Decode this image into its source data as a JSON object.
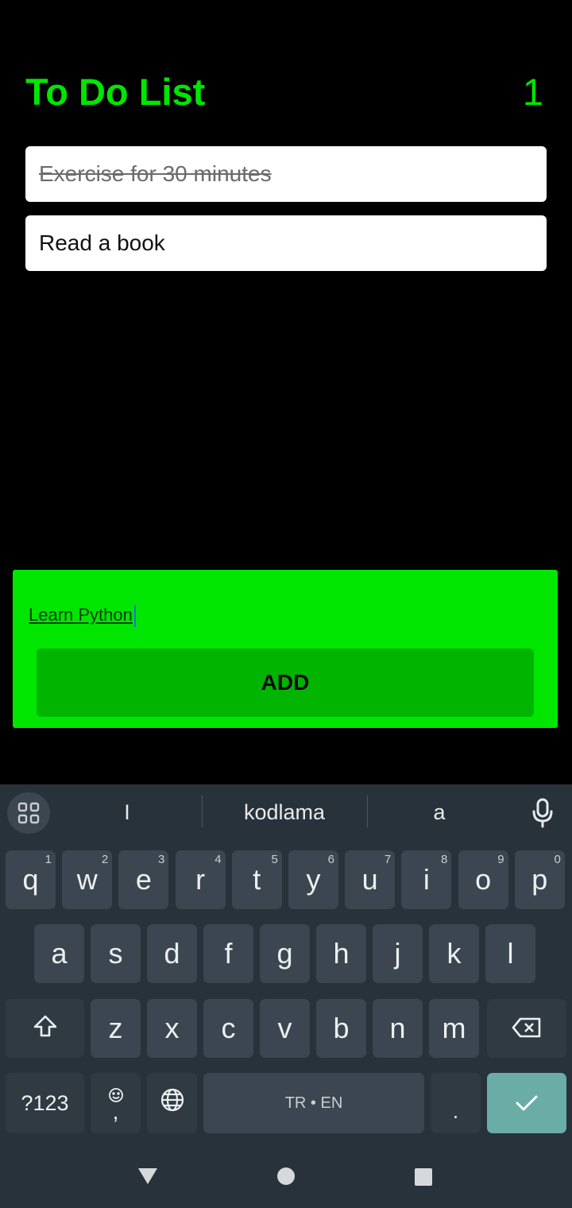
{
  "header": {
    "title": "To Do List",
    "count": "1"
  },
  "todos": [
    {
      "text": "Exercise for 30 minutes",
      "done": true
    },
    {
      "text": "Read a book",
      "done": false
    }
  ],
  "input": {
    "value": "Learn Python"
  },
  "add_button": {
    "label": "ADD"
  },
  "colors": {
    "accent": "#00e600",
    "add_button": "#00b400",
    "background": "#000000",
    "keyboard": "#27323a",
    "enter_key": "#6aada6"
  },
  "keyboard": {
    "suggestions": [
      "I",
      "kodlama",
      "a"
    ],
    "row1": [
      {
        "char": "q",
        "hint": "1"
      },
      {
        "char": "w",
        "hint": "2"
      },
      {
        "char": "e",
        "hint": "3"
      },
      {
        "char": "r",
        "hint": "4"
      },
      {
        "char": "t",
        "hint": "5"
      },
      {
        "char": "y",
        "hint": "6"
      },
      {
        "char": "u",
        "hint": "7"
      },
      {
        "char": "i",
        "hint": "8"
      },
      {
        "char": "o",
        "hint": "9"
      },
      {
        "char": "p",
        "hint": "0"
      }
    ],
    "row2": [
      "a",
      "s",
      "d",
      "f",
      "g",
      "h",
      "j",
      "k",
      "l"
    ],
    "row3": [
      "z",
      "x",
      "c",
      "v",
      "b",
      "n",
      "m"
    ],
    "symbols_label": "?123",
    "emoji_comma": ",",
    "space_label": "TR • EN",
    "period": ".",
    "icons": [
      "apps-grid-icon",
      "microphone-icon",
      "shift-icon",
      "backspace-icon",
      "emoji-icon",
      "globe-icon",
      "checkmark-icon"
    ]
  },
  "navbar": {
    "icons": [
      "back-triangle-icon",
      "home-circle-icon",
      "recents-square-icon"
    ]
  }
}
